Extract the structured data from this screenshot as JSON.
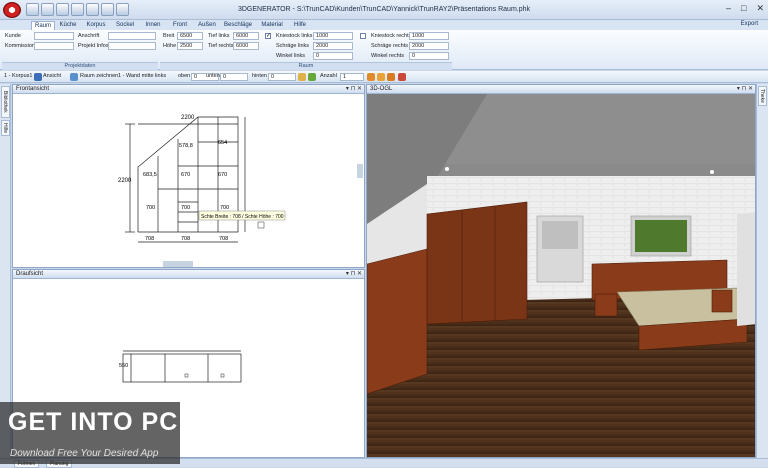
{
  "app": {
    "title": "3DGENERATOR  -  S:\\TrunCAD\\Kunden\\TrunCAD\\Yannick\\TrunRAY2\\Präsentations Raum.phk",
    "export_label": "Export"
  },
  "tabs": [
    "Raum",
    "Küche",
    "Korpus",
    "Sockel",
    "Innen",
    "Front",
    "Außen",
    "Beschläge",
    "Material",
    "Hilfe"
  ],
  "ribbon": {
    "kunde_label": "Kunde",
    "kommission_label": "Kommission",
    "anschrift_label": "Anschrift",
    "projekt_infos_label": "Projekt Infos",
    "breit_label": "Breit",
    "breit_value": "6500",
    "hoehe_label": "Höhe",
    "hoehe_value": "2500",
    "tief_links_label": "Tief links",
    "tief_links_value": "6000",
    "tief_rechts_label": "Tief rechts",
    "tief_rechts_value": "6000",
    "kniestock_links_label": "Kniestock links",
    "kniestock_links_value": "1000",
    "schraege_links_label": "Schräge links",
    "schraege_links_value": "2000",
    "winkel_links_label": "Winkel links",
    "winkel_links_value": "0",
    "kniestock_rechts_label": "Kniestock rechts",
    "kniestock_rechts_value": "1000",
    "schraege_rechts_label": "Schräge rechts",
    "schraege_rechts_value": "2000",
    "winkel_rechts_label": "Winkel rechts",
    "winkel_rechts_value": "0",
    "group_projektdaten": "Projektdaten",
    "group_raum": "Raum"
  },
  "toolbar": {
    "korpus": "1 - Korpus1",
    "ansicht": "Ansicht",
    "raum_zeichnen": "Raum zeichnen",
    "wand_mitte_links": "1 - Wand mitte links",
    "oben_label": "oben",
    "oben_value": "0",
    "unten_label": "unten",
    "unten_value": "0",
    "hinten_label": "hinten",
    "hinten_value": "0",
    "anzahl_label": "Anzahl",
    "anzahl_value": "1"
  },
  "left_tabs": [
    "Bibliothek",
    "Hilfe"
  ],
  "right_tabs": [
    "Theke"
  ],
  "panels": {
    "front": "Frontansicht",
    "top": "Draufsicht",
    "ogl": "3D-OGL"
  },
  "drawing": {
    "dim_width_top": "2200",
    "dim_height_left": "2200",
    "dim_sub": "578,8",
    "dim_654": "654",
    "dim_683": "683,5",
    "dim_670a": "670",
    "dim_670b": "670",
    "dim_700a": "700",
    "dim_700b": "700",
    "dim_700c": "700",
    "dim_708a": "708",
    "dim_708b": "708",
    "dim_708c": "708",
    "tooltip": "Schte Breite : 708 / Schte Höhe : 700",
    "top_dim": "550"
  },
  "status": {
    "tab1": "Formen",
    "tab2": "Planung"
  },
  "watermark": {
    "title": "GET INTO PC",
    "subtitle": "Download Free Your Desired App"
  }
}
